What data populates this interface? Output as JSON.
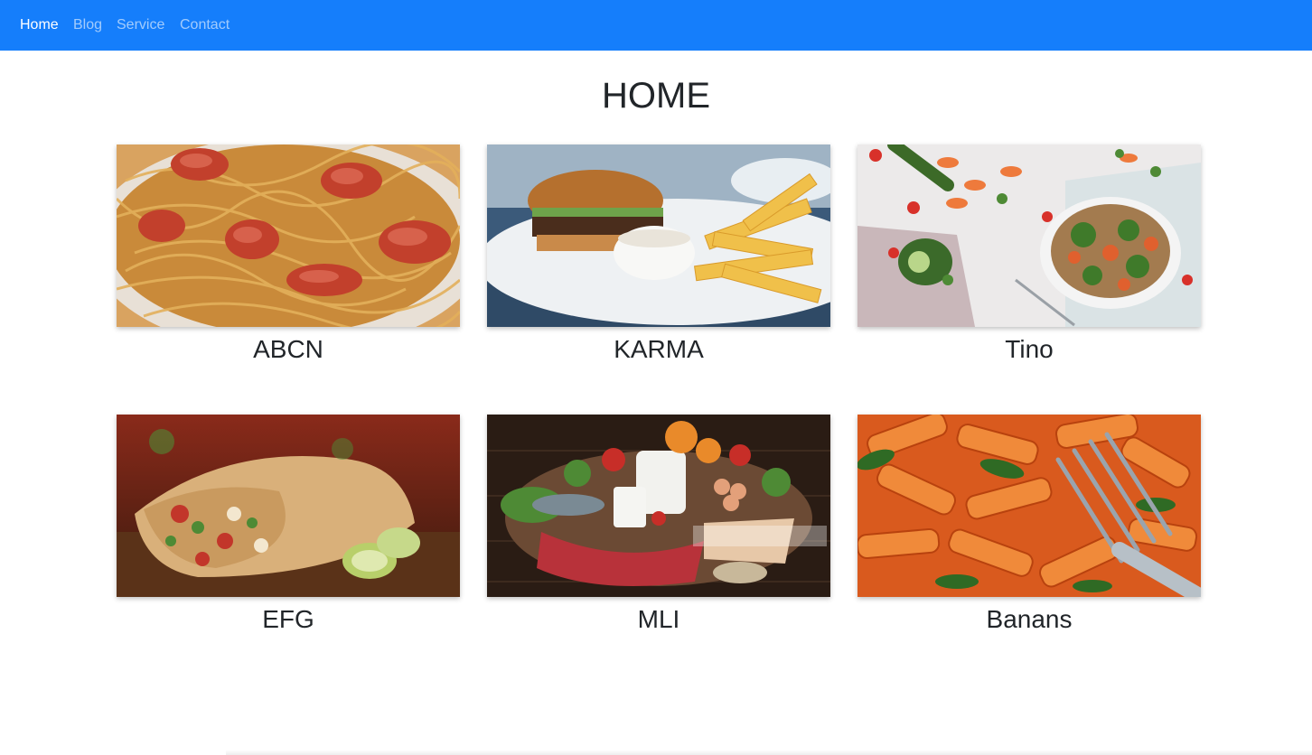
{
  "nav": {
    "items": [
      {
        "label": "Home",
        "active": true
      },
      {
        "label": "Blog",
        "active": false
      },
      {
        "label": "Service",
        "active": false
      },
      {
        "label": "Contact",
        "active": false
      }
    ]
  },
  "page": {
    "title": "HOME"
  },
  "cards": [
    {
      "title": "ABCN",
      "image": "spaghetti-sausage-photo"
    },
    {
      "title": "KARMA",
      "image": "burger-fries-photo"
    },
    {
      "title": "Tino",
      "image": "salad-bowl-photo"
    },
    {
      "title": "EFG",
      "image": "burrito-photo"
    },
    {
      "title": "MLI",
      "image": "groceries-assortment-photo"
    },
    {
      "title": "Banans",
      "image": "penne-pasta-photo"
    }
  ],
  "colors": {
    "navbar": "#157efb",
    "text": "#212529"
  }
}
